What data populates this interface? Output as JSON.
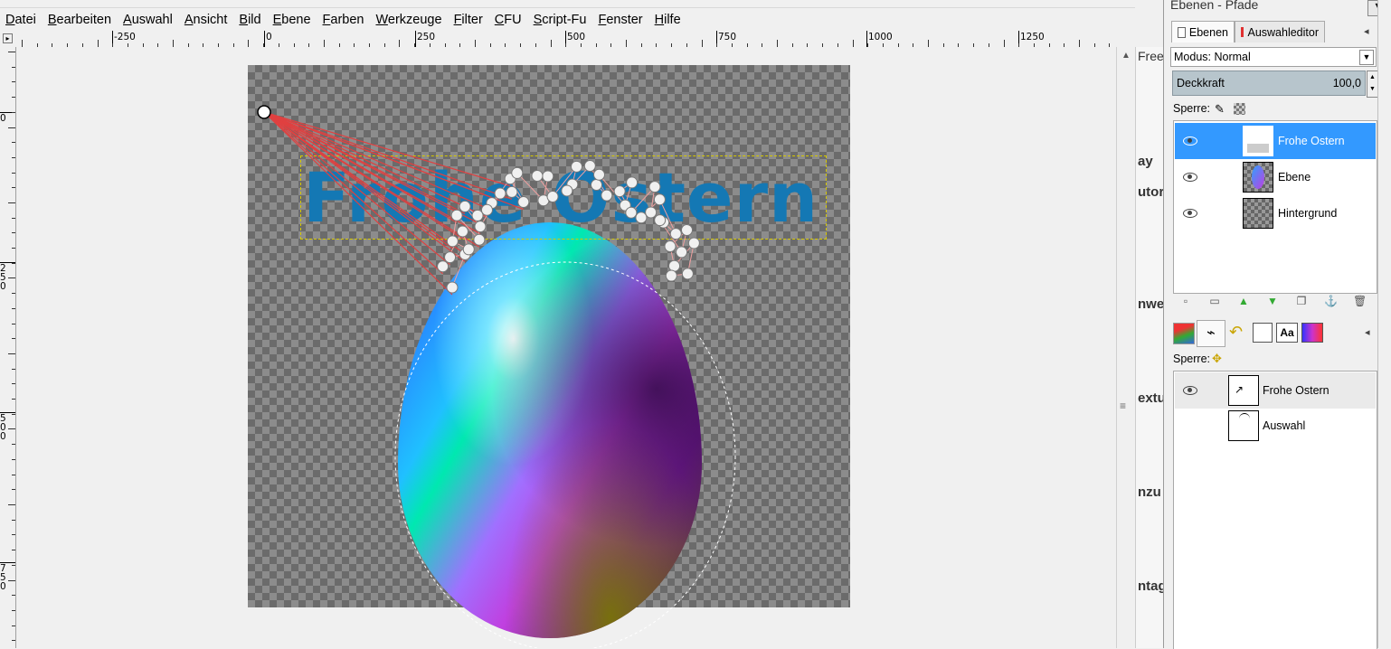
{
  "menubar": {
    "items": [
      "Datei",
      "Bearbeiten",
      "Auswahl",
      "Ansicht",
      "Bild",
      "Ebene",
      "Farben",
      "Werkzeuge",
      "Filter",
      "CFU",
      "Script-Fu",
      "Fenster",
      "Hilfe"
    ]
  },
  "ruler": {
    "h_labels": [
      "-250",
      "0",
      "250",
      "500",
      "750",
      "1000",
      "1250"
    ],
    "v_labels": [
      "0",
      "250",
      "500",
      "750"
    ]
  },
  "canvas": {
    "text_layer": "Frohe Ostern"
  },
  "background_window": {
    "fragments": [
      "Free",
      "ay",
      "utor",
      "nwe",
      "extu",
      "nzu",
      "ntag"
    ]
  },
  "dock": {
    "title": "Ebenen - Pfade",
    "tabs": [
      "Ebenen",
      "Auswahleditor"
    ],
    "mode_label": "Modus: Normal",
    "opacity_label": "Deckkraft",
    "opacity_value": "100,0",
    "lock_label": "Sperre:",
    "layers": [
      {
        "name": "Frohe Ostern",
        "selected": true
      },
      {
        "name": "Ebene",
        "selected": false
      },
      {
        "name": "Hintergrund",
        "selected": false
      }
    ],
    "paths_lock_label": "Sperre:",
    "paths": [
      {
        "name": "Frohe Ostern",
        "visible": true
      },
      {
        "name": "Auswahl",
        "visible": false
      }
    ],
    "text_tab_icon": "Aa"
  },
  "colors": {
    "selection": "#3399ff",
    "text_layer": "#1478b4",
    "path_red": "#e04040"
  }
}
